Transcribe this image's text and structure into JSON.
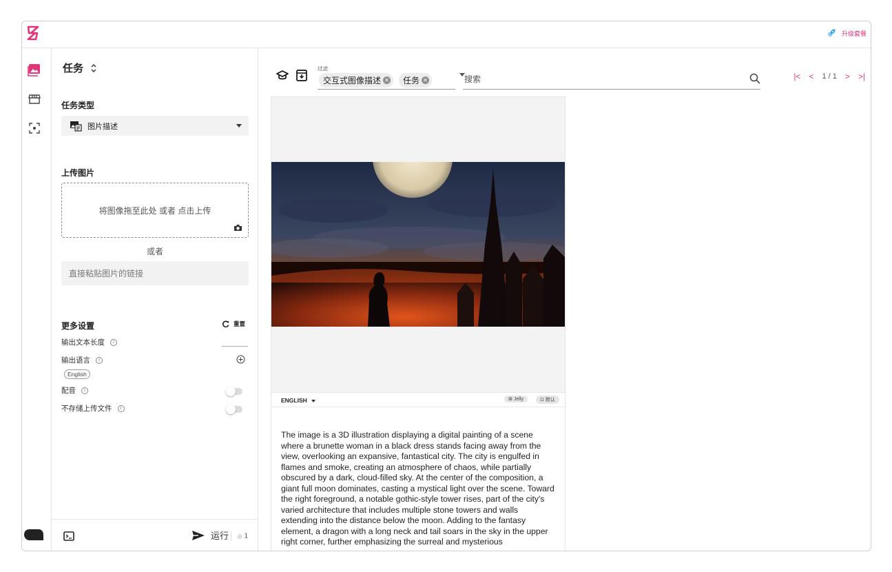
{
  "app": {
    "upgrade_label": "升级套餐",
    "accent_color": "#e0357a"
  },
  "left_panel": {
    "title": "任务",
    "task_type_label": "任务类型",
    "task_type_value": "图片描述",
    "upload_label": "上传图片",
    "dropzone_text": "将图像拖至此处 或者 点击上传",
    "or_text": "或者",
    "url_placeholder": "直接粘贴图片的链接",
    "more_settings_label": "更多设置",
    "reset_label": "重置",
    "settings": {
      "output_length_label": "输出文本长度",
      "output_language_label": "输出语言",
      "language_chip": "English",
      "dubbing_label": "配音",
      "no_store_label": "不存储上传文件"
    },
    "run_label": "运行",
    "credit_count": "1"
  },
  "toolbar": {
    "filter_label": "过滤",
    "filter_chips": [
      "交互式图像描述",
      "任务"
    ],
    "search_placeholder": "搜索",
    "page_indicator": "1 / 1"
  },
  "result": {
    "language": "ENGLISH",
    "voice_label": "Jelly",
    "default_label": "默认",
    "description": "The image is a 3D illustration displaying a digital painting of a scene where a brunette woman in a black dress stands facing away from the view, overlooking an expansive, fantastical city. The city is engulfed in flames and smoke, creating an atmosphere of chaos, while partially obscured by a dark, cloud-filled sky. At the center of the composition, a giant full moon dominates, casting a mystical light over the scene. Toward the right foreground, a notable gothic-style tower rises, part of the city's varied architecture that includes multiple stone towers and walls extending into the distance below the moon. Adding to the fantasy element, a dragon with a long neck and tail soars in the sky in the upper right corner, further emphasizing the surreal and mysterious"
  }
}
